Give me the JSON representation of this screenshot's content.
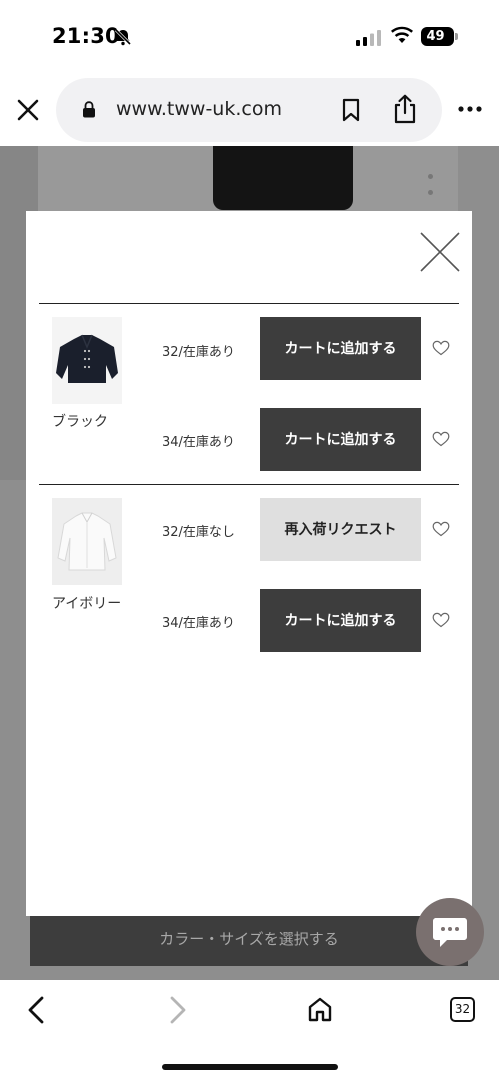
{
  "status_bar": {
    "time": "21:30",
    "battery": "49"
  },
  "browser": {
    "url": "www.tww-uk.com",
    "tab_count": "32"
  },
  "page": {
    "select_button_label": "カラー・サイズを選択する"
  },
  "modal": {
    "products": [
      {
        "color": "ブラック",
        "variants": [
          {
            "stock_label": "32/在庫あり",
            "action_label": "カートに追加する"
          },
          {
            "stock_label": "34/在庫あり",
            "action_label": "カートに追加する"
          }
        ]
      },
      {
        "color": "アイボリー",
        "variants": [
          {
            "stock_label": "32/在庫なし",
            "action_label": "再入荷リクエスト"
          },
          {
            "stock_label": "34/在庫あり",
            "action_label": "カートに追加する"
          }
        ]
      }
    ]
  },
  "colors": {
    "dark_button": "#3d3d3d",
    "restock_button": "#dfdfdf",
    "overlay": "#8e8e8e"
  },
  "icons": {
    "status": [
      "bell-slash-icon",
      "signal-icon",
      "wifi-icon"
    ],
    "browser": [
      "close-icon",
      "lock-icon",
      "bookmark-icon",
      "share-icon",
      "more-icon"
    ],
    "toolbar": [
      "back-icon",
      "forward-icon",
      "home-icon",
      "tabs-icon"
    ],
    "modal": [
      "close-icon",
      "heart-icon",
      "chat-icon"
    ]
  }
}
